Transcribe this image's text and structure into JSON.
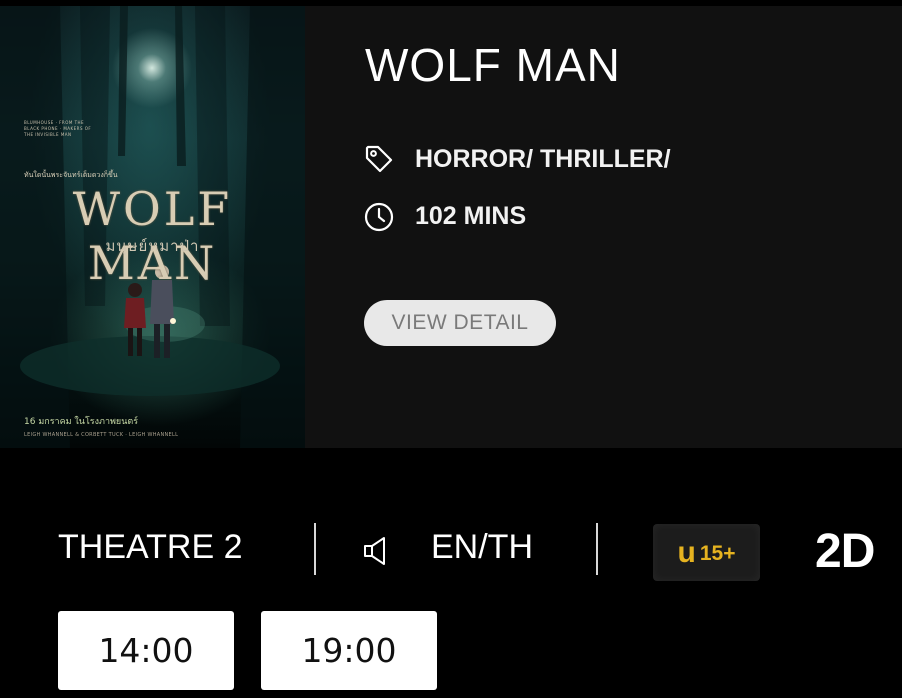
{
  "poster": {
    "title": "WOLF MAN",
    "subtitle": "มนุษย์หมาป่า",
    "tagline": "ทันใดนั้นพระจันทร์เต็มดวงก็ขึ้น",
    "credits": "BLUMHOUSE · FROM THE BLACK PHONE · MAKERS OF THE INVISIBLE MAN",
    "date": "16 มกราคม ในโรงภาพยนตร์",
    "billing": "LEIGH WHANNELL & CORBETT TUCK · LEIGH WHANNELL"
  },
  "movie": {
    "title": "WOLF MAN",
    "genre": "HORROR/ THRILLER/",
    "duration": "102 MINS",
    "view_detail_label": "VIEW DETAIL"
  },
  "showing": {
    "theatre": "THEATRE 2",
    "audio": "EN/TH",
    "rating_letter": "u",
    "rating_age": "15+",
    "format": "2D"
  },
  "showtimes": [
    "14:00",
    "19:00"
  ],
  "colors": {
    "background": "#000000",
    "panel": "#111111",
    "rating_gold": "#e6b320",
    "button_bg": "#e8e8e8",
    "button_text": "#7a7a7a"
  },
  "icons": {
    "genre": "tag-icon",
    "duration": "clock-icon",
    "audio": "speaker-icon"
  }
}
